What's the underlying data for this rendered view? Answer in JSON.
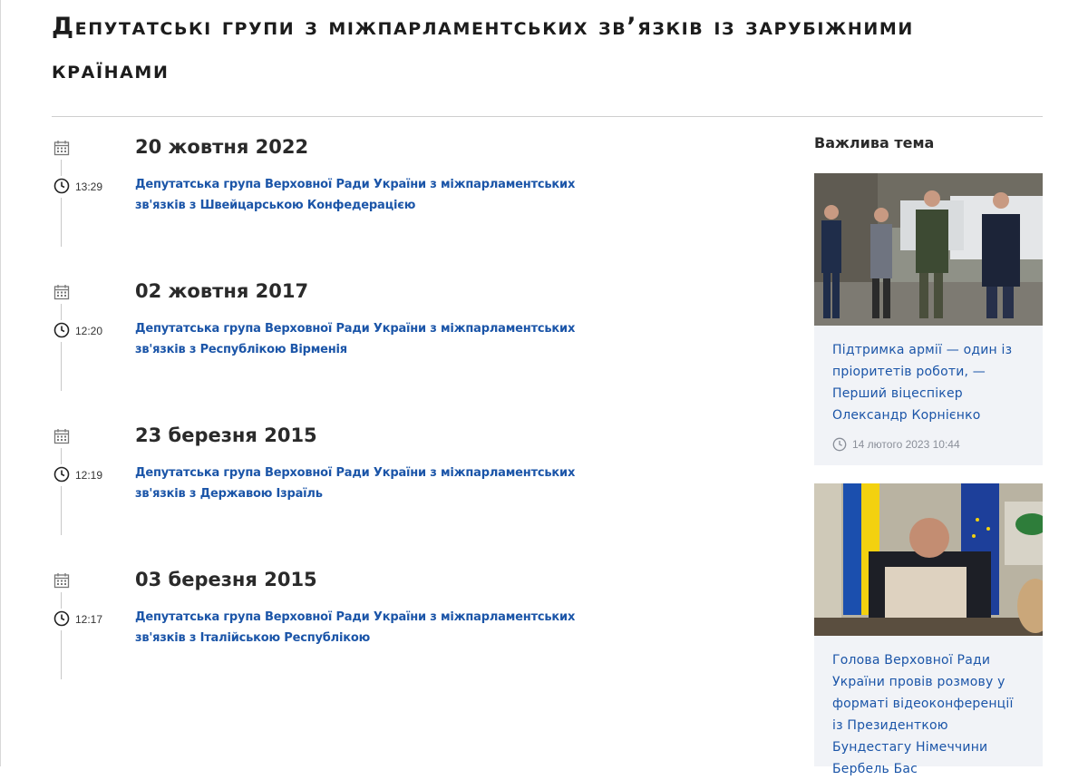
{
  "page": {
    "title": "Депутатські групи з міжпарламентських зв’язків із зарубіжними країнами"
  },
  "timeline": [
    {
      "date": "20 жовтня 2022",
      "time": "13:29",
      "link": "Депутатська група Верховної Ради України з міжпарламентських зв'язків з Швейцарською Конфедерацією"
    },
    {
      "date": "02 жовтня 2017",
      "time": "12:20",
      "link": "Депутатська група Верховної Ради України з міжпарламентських зв'язків з Республікою Вірменія"
    },
    {
      "date": "23 березня 2015",
      "time": "12:19",
      "link": "Депутатська група Верховної Ради України з міжпарламентських зв'язків з Державою Ізраїль"
    },
    {
      "date": "03 березня 2015",
      "time": "12:17",
      "link": "Депутатська група Верховної Ради України з міжпарламентських зв'язків з Італійською Республікою"
    }
  ],
  "sidebar": {
    "heading": "Важлива тема",
    "cards": [
      {
        "text": "Підтримка армії — один із пріоритетів роботи, — Перший віцеспікер Олександр Корнієнко",
        "meta": "14 лютого 2023 10:44"
      },
      {
        "text": "Голова Верховної Ради України провів розмову у форматі відеоконференції із Президенткою Бундестагу Німеччини Бербель Бас"
      }
    ]
  },
  "colors": {
    "link": "#1b55a8",
    "card_bg": "#f1f3f7"
  }
}
